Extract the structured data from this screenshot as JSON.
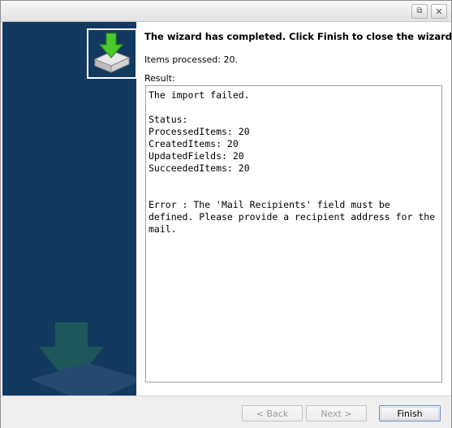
{
  "window": {
    "titlebar_icons": [
      "popout-icon",
      "close-icon"
    ],
    "popout_glyph": "⧉",
    "close_glyph": "✕"
  },
  "wizard": {
    "heading": "The wizard has completed. Click Finish to close the wizard.",
    "items_processed": "Items processed: 20.",
    "result_label": "Result:",
    "result_text": "The import failed.\n\nStatus:\nProcessedItems: 20\nCreatedItems: 20\nUpdatedFields: 20\nSucceededItems: 20\n\n\nError : The 'Mail Recipients' field must be defined. Please provide a recipient address for the mail."
  },
  "footer": {
    "back_label": "< Back",
    "next_label": "Next >",
    "finish_label": "Finish"
  },
  "colors": {
    "sidebar_bg": "#123a61",
    "icon_arrow": "#4cc92e"
  }
}
